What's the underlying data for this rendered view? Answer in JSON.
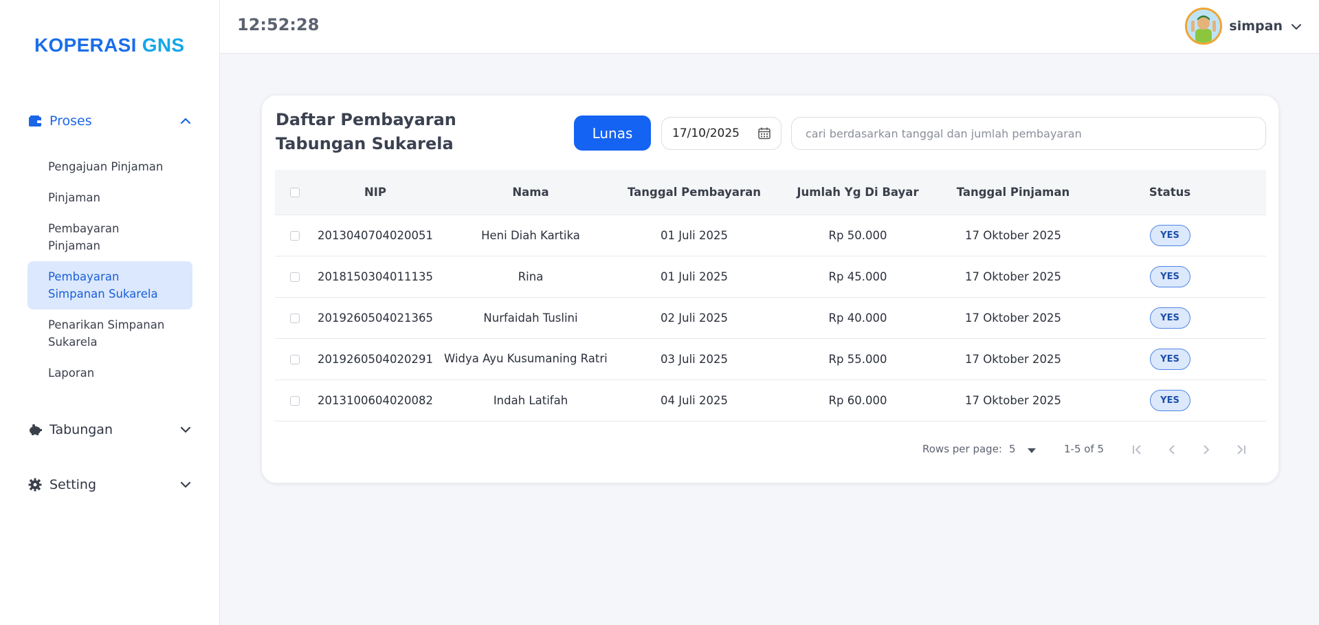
{
  "sidebar": {
    "logo_part1": "KOPERASI",
    "logo_part2": "GNS",
    "groups": [
      {
        "label": "Proses",
        "icon": "wallet-icon",
        "expanded": true
      },
      {
        "label": "Tabungan",
        "icon": "piggy-bank-icon",
        "expanded": false
      },
      {
        "label": "Setting",
        "icon": "gear-icon",
        "expanded": false
      }
    ],
    "proses_items": [
      {
        "label": "Pengajuan Pinjaman"
      },
      {
        "label": "Pinjaman"
      },
      {
        "label": "Pembayaran Pinjaman"
      },
      {
        "label": "Pembayaran Simpanan Sukarela",
        "active": true
      },
      {
        "label": "Penarikan Simpanan Sukarela"
      },
      {
        "label": "Laporan"
      }
    ]
  },
  "header": {
    "clock": "12:52:28",
    "username": "simpan"
  },
  "main": {
    "title": "Daftar Pembayaran Tabungan Sukarela",
    "lunas_label": "Lunas",
    "date_value": "17/10/2025",
    "search_placeholder": "cari berdasarkan tanggal dan jumlah pembayaran",
    "columns": [
      "NIP",
      "Nama",
      "Tanggal Pembayaran",
      "Jumlah Yg Di Bayar",
      "Tanggal Pinjaman",
      "Status"
    ],
    "rows": [
      {
        "nip": "2013040704020051",
        "nama": "Heni Diah Kartika",
        "tgl_bayar": "01 Juli 2025",
        "jumlah": "Rp 50.000",
        "tgl_pinjam": "17 Oktober 2025",
        "status": "YES"
      },
      {
        "nip": "2018150304011135",
        "nama": "Rina",
        "tgl_bayar": "01 Juli 2025",
        "jumlah": "Rp 45.000",
        "tgl_pinjam": "17 Oktober 2025",
        "status": "YES"
      },
      {
        "nip": "2019260504021365",
        "nama": "Nurfaidah Tuslini",
        "tgl_bayar": "02 Juli 2025",
        "jumlah": "Rp 40.000",
        "tgl_pinjam": "17 Oktober 2025",
        "status": "YES"
      },
      {
        "nip": "2019260504020291",
        "nama": "Widya Ayu Kusumaning Ratri",
        "tgl_bayar": "03 Juli 2025",
        "jumlah": "Rp 55.000",
        "tgl_pinjam": "17 Oktober 2025",
        "status": "YES"
      },
      {
        "nip": "2013100604020082",
        "nama": "Indah Latifah",
        "tgl_bayar": "04 Juli 2025",
        "jumlah": "Rp 60.000",
        "tgl_pinjam": "17 Oktober 2025",
        "status": "YES"
      }
    ],
    "pagination": {
      "rows_per_page_label": "Rows per page:",
      "rows_per_page": "5",
      "range": "1-5 of 5"
    }
  },
  "colors": {
    "primary": "#1463f3",
    "active_bg": "#dbe8fd",
    "badge_bg": "#dce8fb",
    "logo_blue": "#1b6ee8",
    "logo_cyan": "#14a7e8"
  }
}
